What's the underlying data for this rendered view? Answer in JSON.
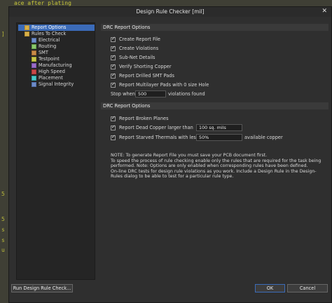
{
  "background": {
    "top_text": "ace after plating",
    "left_marks": [
      "]",
      "5",
      "5",
      "s",
      "s",
      "u"
    ]
  },
  "dialog": {
    "title": "Design Rule Checker [mil]",
    "close_glyph": "✕"
  },
  "tree": {
    "items": [
      {
        "label": "Report Options",
        "icon": "folder-icon",
        "selected": true
      },
      {
        "label": "Rules To Check",
        "icon": "folder-icon",
        "selected": false
      },
      {
        "label": "Electrical",
        "icon": "electrical-rule-icon",
        "selected": false
      },
      {
        "label": "Routing",
        "icon": "routing-rule-icon",
        "selected": false
      },
      {
        "label": "SMT",
        "icon": "smt-rule-icon",
        "selected": false
      },
      {
        "label": "Testpoint",
        "icon": "testpoint-rule-icon",
        "selected": false
      },
      {
        "label": "Manufacturing",
        "icon": "manufacturing-rule-icon",
        "selected": false
      },
      {
        "label": "High Speed",
        "icon": "high-speed-rule-icon",
        "selected": false
      },
      {
        "label": "Placement",
        "icon": "placement-rule-icon",
        "selected": false
      },
      {
        "label": "Signal Integrity",
        "icon": "signal-integrity-rule-icon",
        "selected": false
      }
    ]
  },
  "drc_report_options_1": {
    "header": "DRC Report Options",
    "checkboxes": [
      {
        "label": "Create Report File",
        "checked": true
      },
      {
        "label": "Create Violations",
        "checked": true
      },
      {
        "label": "Sub-Net Details",
        "checked": true
      },
      {
        "label": "Verify Shorting Copper",
        "checked": true
      },
      {
        "label": "Report Drilled SMT Pads",
        "checked": true
      },
      {
        "label": "Report Multilayer Pads with 0 size Hole",
        "checked": true
      }
    ],
    "stop_when_label": "Stop when",
    "stop_when_value": "500",
    "violations_found_label": "violations found"
  },
  "drc_report_options_2": {
    "header": "DRC Report Options",
    "broken_planes_label": "Report Broken Planes",
    "dead_copper_label": "Report Dead Copper larger than",
    "dead_copper_value": "100 sq. mils",
    "starved_thermals_label": "Report Starved Thermals with less than",
    "starved_thermals_value": "50%",
    "available_copper_label": "available copper"
  },
  "note": "NOTE: To generate Report File you must save your PCB document first.\nTo speed the process of rule checking enable only the rules that are required for the task being performed.  Note: Options are only enabled when corresponding rules have been defined.\nOn-line DRC tests for design rule violations as you work. Include a Design Rule in the Design-Rules dialog to be able to test for a particular rule  type.",
  "buttons": {
    "run": "Run Design Rule Check...",
    "ok": "OK",
    "cancel": "Cancel"
  },
  "colors": {
    "selection": "#3b6bb8",
    "dialog_bg": "#2f2f2f",
    "panel_bg": "#252525",
    "section_header_bg": "#3a3a3a"
  }
}
